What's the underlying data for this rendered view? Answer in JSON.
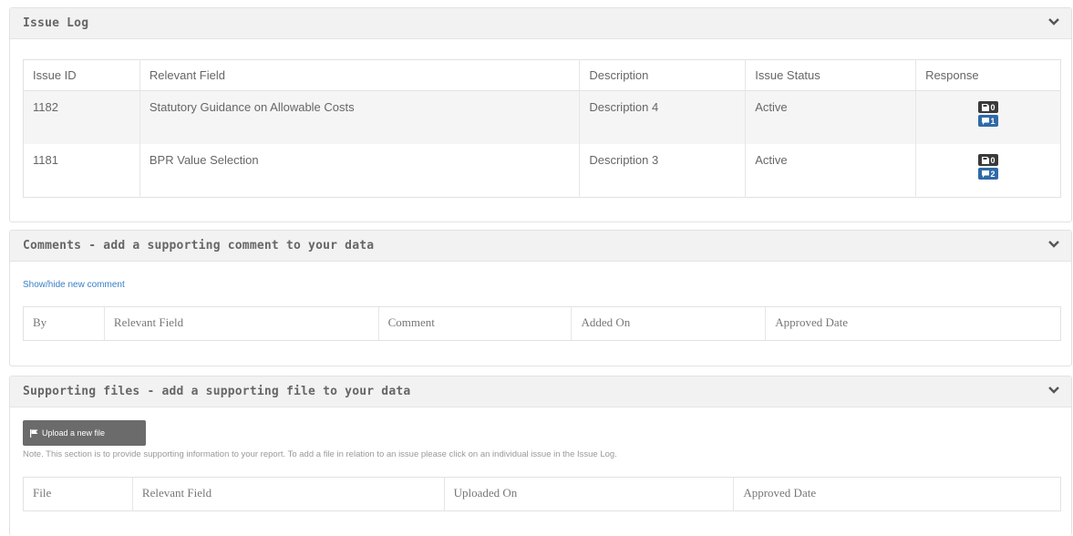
{
  "issue_log": {
    "title": "Issue Log",
    "columns": [
      "Issue ID",
      "Relevant Field",
      "Description",
      "Issue Status",
      "Response"
    ],
    "rows": [
      {
        "id": "1182",
        "field": "Statutory Guidance on Allowable Costs",
        "description": "Description 4",
        "status": "Active",
        "files": "0",
        "comments": "1"
      },
      {
        "id": "1181",
        "field": "BPR Value Selection",
        "description": "Description 3",
        "status": "Active",
        "files": "0",
        "comments": "2"
      }
    ]
  },
  "comments": {
    "title": "Comments - add a supporting comment to your data",
    "toggle_link": "Show/hide new comment",
    "columns": [
      "By",
      "Relevant Field",
      "Comment",
      "Added On",
      "Approved Date"
    ]
  },
  "files": {
    "title": "Supporting files - add a supporting file to your data",
    "upload_label": "Upload a new file",
    "note": "Note. This section is to provide supporting information to your report. To add a file in relation to an issue please click on an individual issue in the Issue Log.",
    "columns": [
      "File",
      "Relevant Field",
      "Uploaded On",
      "Approved Date"
    ]
  },
  "colors": {
    "panel_header_bg": "#f2f2f2",
    "link": "#3a7fc4",
    "badge_dark": "#3a3a3a",
    "badge_blue": "#2f6aa8",
    "button_bg": "#6b6b6b"
  },
  "icons": {
    "collapse": "chevron-down-icon",
    "file": "floppy-icon",
    "comment": "comment-icon",
    "upload": "flag-icon"
  }
}
